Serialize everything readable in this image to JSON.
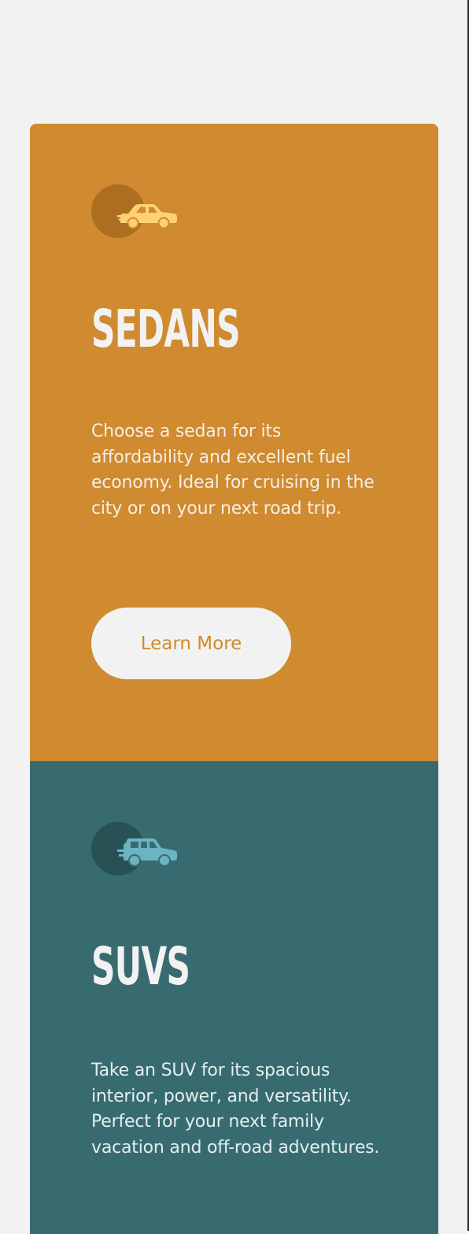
{
  "cards": [
    {
      "id": "sedans",
      "icon": "sedan-car-icon",
      "title": "SEDANS",
      "description": "Choose a sedan for its affordability and excellent fuel economy. Ideal for cruising in the city or on your next road trip.",
      "button_label": "Learn More",
      "background": "#d08a2f",
      "icon_color": "#ffd173"
    },
    {
      "id": "suvs",
      "icon": "suv-car-icon",
      "title": "SUVS",
      "description": "Take an SUV for its spacious interior, power, and versatility. Perfect for your next family vacation and off-road adventures.",
      "background": "#386b6f",
      "icon_color": "#6bb4c4"
    }
  ]
}
